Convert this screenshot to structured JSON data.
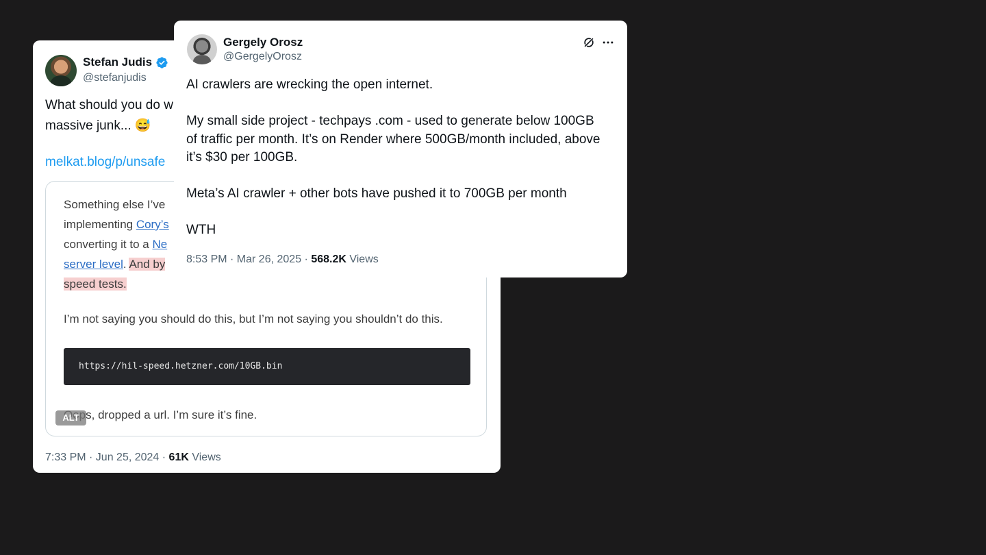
{
  "back_tweet": {
    "author": "Stefan Judis",
    "handle": "@stefanjudis",
    "text_line_1": "What should you do w",
    "text_line_2": "massive junk... 😅",
    "link": "melkat.blog/p/unsafe",
    "quote": {
      "line_1": "Something else I’ve",
      "line_2_prefix": "implementing ",
      "line_2_link": "Cory’s",
      "line_3_prefix": "converting it to a ",
      "line_3_link": "Ne",
      "line_4_link": "server level",
      "line_4_mid": ". ",
      "line_4_highlight": "And by",
      "line_5_highlight": "speed tests.",
      "paragraph_2": "I’m not saying you should do this, but I’m not saying you shouldn’t do this.",
      "code": "https://hil-speed.hetzner.com/10GB.bin",
      "paragraph_3": "Oops, dropped a url. I’m sure it’s fine.",
      "alt_badge": "ALT"
    },
    "time": "7:33 PM · Jun 25, 2024 · ",
    "views_count": "61K",
    "views_label": " Views"
  },
  "front_tweet": {
    "author": "Gergely Orosz",
    "handle": "@GergelyOrosz",
    "lines": [
      "AI crawlers are wrecking the open internet.",
      "My small side project - techpays .com - used to generate below 100GB",
      "of traffic per month. It’s on Render where 500GB/month included, above",
      "it’s $30 per 100GB.",
      "Meta’s AI crawler + other bots have pushed it to 700GB per month",
      "WTH"
    ],
    "time": "8:53 PM · Mar 26, 2025 · ",
    "views_count": "568.2K",
    "views_label": " Views"
  },
  "colors": {
    "background": "#1b1a1b",
    "link": "#1d9bf0",
    "verified": "#1d9bf0",
    "secondary_text": "#536471"
  },
  "icons": [
    "verified-badge-icon",
    "grok-icon",
    "more-options-icon"
  ]
}
